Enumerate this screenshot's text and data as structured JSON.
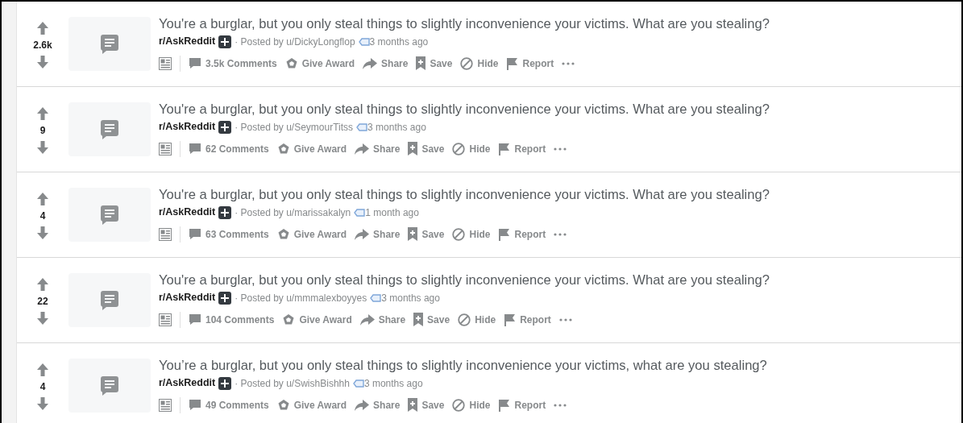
{
  "posts": [
    {
      "votes": "2.6k",
      "title": "You're a burglar, but you only steal things to slightly inconvenience your victims. What are you stealing?",
      "subreddit": "r/AskReddit",
      "posted_by": "· Posted by u/DickyLongflop",
      "age": "3 months ago",
      "actions": [
        {
          "kind": "comments",
          "label": "3.5k Comments"
        },
        {
          "kind": "award",
          "label": "Give Award"
        },
        {
          "kind": "share",
          "label": "Share"
        },
        {
          "kind": "save",
          "label": "Save"
        },
        {
          "kind": "hide",
          "label": "Hide"
        },
        {
          "kind": "report",
          "label": "Report"
        }
      ]
    },
    {
      "votes": "9",
      "title": "You're a burglar, but you only steal things to slightly inconvenience your victims. What are you stealing?",
      "subreddit": "r/AskReddit",
      "posted_by": "· Posted by u/SeymourTitss",
      "age": "3 months ago",
      "actions": [
        {
          "kind": "comments",
          "label": "62 Comments"
        },
        {
          "kind": "award",
          "label": "Give Award"
        },
        {
          "kind": "share",
          "label": "Share"
        },
        {
          "kind": "save",
          "label": "Save"
        },
        {
          "kind": "hide",
          "label": "Hide"
        },
        {
          "kind": "report",
          "label": "Report"
        }
      ]
    },
    {
      "votes": "4",
      "title": "You're a burglar, but you only steal things to slightly inconvenience your victims. What are you stealing?",
      "subreddit": "r/AskReddit",
      "posted_by": "· Posted by u/marissakalyn",
      "age": "1 month ago",
      "actions": [
        {
          "kind": "comments",
          "label": "63 Comments"
        },
        {
          "kind": "award",
          "label": "Give Award"
        },
        {
          "kind": "share",
          "label": "Share"
        },
        {
          "kind": "save",
          "label": "Save"
        },
        {
          "kind": "hide",
          "label": "Hide"
        },
        {
          "kind": "report",
          "label": "Report"
        }
      ]
    },
    {
      "votes": "22",
      "title": "You're a burglar, but you only steal things to slightly inconvenience your victims. What are you stealing?",
      "subreddit": "r/AskReddit",
      "posted_by": "· Posted by u/mmmalexboyyes",
      "age": "3 months ago",
      "actions": [
        {
          "kind": "comments",
          "label": "104 Comments"
        },
        {
          "kind": "award",
          "label": "Give Award"
        },
        {
          "kind": "share",
          "label": "Share"
        },
        {
          "kind": "save",
          "label": "Save"
        },
        {
          "kind": "hide",
          "label": "Hide"
        },
        {
          "kind": "report",
          "label": "Report"
        }
      ]
    },
    {
      "votes": "4",
      "title": "You’re a burglar, but you only steal things to slightly inconvenience your victims, what are you stealing?",
      "subreddit": "r/AskReddit",
      "posted_by": "· Posted by u/SwishBishhh",
      "age": "3 months ago",
      "actions": [
        {
          "kind": "comments",
          "label": "49 Comments"
        },
        {
          "kind": "award",
          "label": "Give Award"
        },
        {
          "kind": "share",
          "label": "Share"
        },
        {
          "kind": "save",
          "label": "Save"
        },
        {
          "kind": "hide",
          "label": "Hide"
        },
        {
          "kind": "report",
          "label": "Report"
        }
      ]
    }
  ]
}
